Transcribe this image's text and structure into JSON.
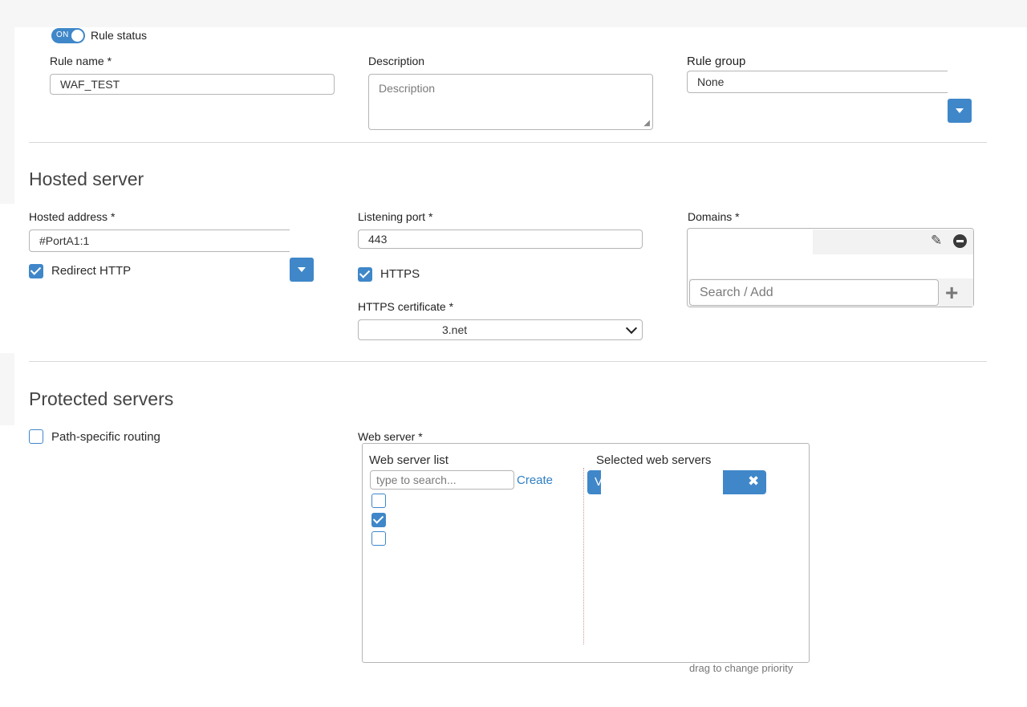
{
  "rule": {
    "status_label": "Rule status",
    "status_toggle_text": "ON",
    "name_label": "Rule name *",
    "name_value": "WAF_TEST",
    "description_label": "Description",
    "description_placeholder": "Description",
    "group_label": "Rule group",
    "group_value": "None"
  },
  "hosted_server": {
    "title": "Hosted server",
    "address_label": "Hosted address *",
    "address_value": "#PortA1:1",
    "redirect_http_label": "Redirect HTTP",
    "redirect_http_checked": true,
    "port_label": "Listening port *",
    "port_value": "443",
    "https_label": "HTTPS",
    "https_checked": true,
    "cert_label": "HTTPS certificate *",
    "cert_value": "3.net",
    "domains_label": "Domains *",
    "domains_search_placeholder": "Search / Add"
  },
  "protected_servers": {
    "title": "Protected servers",
    "path_routing_label": "Path-specific routing",
    "path_routing_checked": false,
    "web_server_label": "Web server *",
    "list_title": "Web server list",
    "search_placeholder": "type to search...",
    "create_label": "Create",
    "list_items_checked": [
      false,
      true,
      false
    ],
    "selected_title": "Selected web servers",
    "selected_item_initial": "V",
    "drag_hint": "drag to change priority"
  },
  "colors": {
    "accent": "#3f87c9",
    "link": "#2f7fc4"
  }
}
